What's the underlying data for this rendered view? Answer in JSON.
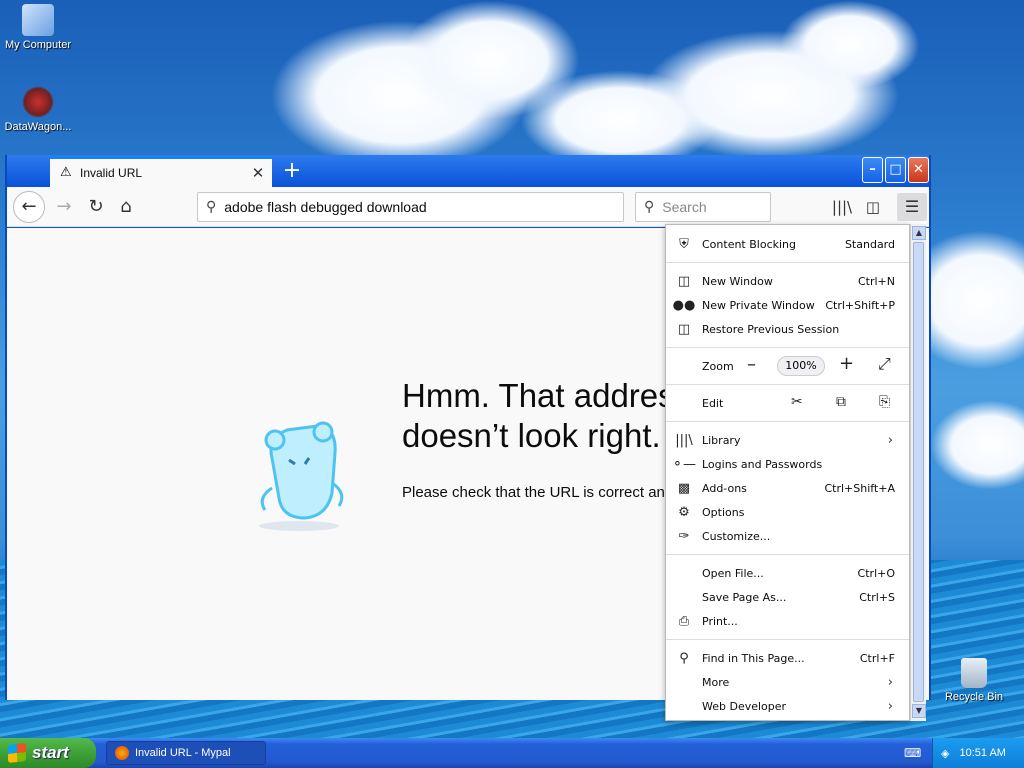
{
  "desktop": {
    "icons": [
      {
        "label": "My Computer"
      },
      {
        "label": "DataWagon..."
      },
      {
        "label": "Recycle Bin"
      }
    ]
  },
  "browser": {
    "tab_title": "Invalid URL",
    "url_value": "adobe flash debugged download",
    "search_placeholder": "Search",
    "error_title": "Hmm. That address doesn’t look right.",
    "error_title_line1": "Hmm. That addres",
    "error_title_line2": "doesn’t look right.",
    "error_text": "Please check that the URL is correct and"
  },
  "menu": {
    "content_blocking": {
      "label": "Content Blocking",
      "value": "Standard"
    },
    "new_window": {
      "label": "New Window",
      "shortcut": "Ctrl+N"
    },
    "new_private_window": {
      "label": "New Private Window",
      "shortcut": "Ctrl+Shift+P"
    },
    "restore_session": {
      "label": "Restore Previous Session"
    },
    "zoom": {
      "label": "Zoom",
      "value": "100%"
    },
    "edit": {
      "label": "Edit"
    },
    "library": {
      "label": "Library"
    },
    "logins": {
      "label": "Logins and Passwords"
    },
    "addons": {
      "label": "Add-ons",
      "shortcut": "Ctrl+Shift+A"
    },
    "options": {
      "label": "Options"
    },
    "customize": {
      "label": "Customize..."
    },
    "open_file": {
      "label": "Open File...",
      "shortcut": "Ctrl+O"
    },
    "save_page": {
      "label": "Save Page As...",
      "shortcut": "Ctrl+S"
    },
    "print": {
      "label": "Print..."
    },
    "find": {
      "label": "Find in This Page...",
      "shortcut": "Ctrl+F"
    },
    "more": {
      "label": "More"
    },
    "web_developer": {
      "label": "Web Developer"
    }
  },
  "taskbar": {
    "start_label": "start",
    "task_label": "Invalid URL - Mypal",
    "clock": "10:51 AM"
  }
}
